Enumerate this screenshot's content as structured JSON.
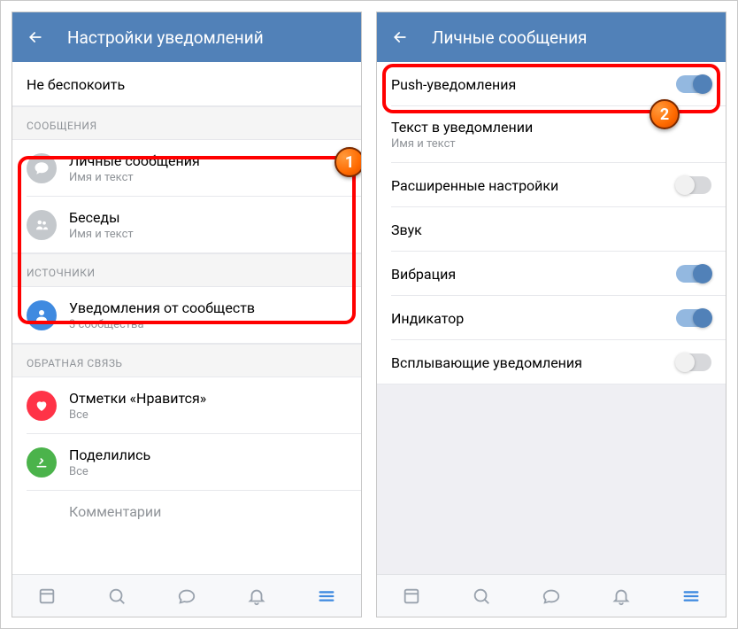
{
  "left": {
    "title": "Настройки уведомлений",
    "dnd": "Не беспокоить",
    "sections": {
      "messages_header": "СООБЩЕНИЯ",
      "personal": {
        "title": "Личные сообщения",
        "sub": "Имя и текст"
      },
      "chats": {
        "title": "Беседы",
        "sub": "Имя и текст"
      },
      "sources_header": "ИСТОЧНИКИ",
      "communities": {
        "title": "Уведомления от сообществ",
        "sub": "3 сообщества"
      },
      "feedback_header": "ОБРАТНАЯ СВЯЗЬ",
      "likes": {
        "title": "Отметки «Нравится»",
        "sub": "Все"
      },
      "shares": {
        "title": "Поделились",
        "sub": "Все"
      },
      "comments": {
        "title": "Комментарии"
      }
    }
  },
  "right": {
    "title": "Личные сообщения",
    "push": "Push-уведомления",
    "text_in_notif": {
      "title": "Текст в уведомлении",
      "sub": "Имя и текст"
    },
    "advanced": "Расширенные настройки",
    "sound": "Звук",
    "vibration": "Вибрация",
    "indicator": "Индикатор",
    "popup": "Всплывающие уведомления"
  },
  "badges": {
    "one": "1",
    "two": "2"
  }
}
